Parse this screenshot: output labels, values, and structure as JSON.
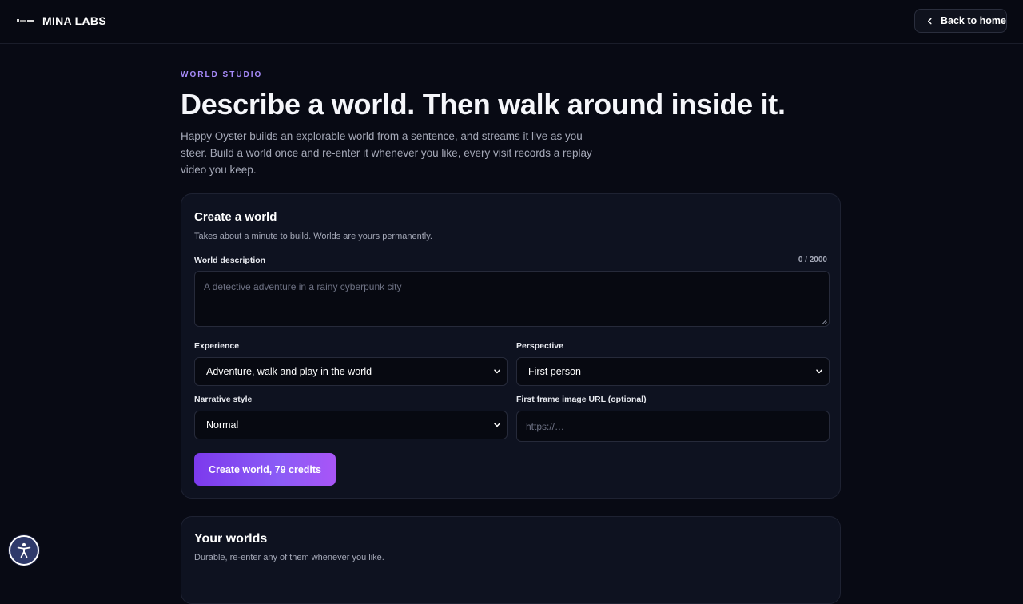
{
  "header": {
    "brand_name": "MINA LABS",
    "back_label": "Back to home"
  },
  "hero": {
    "eyebrow": "WORLD STUDIO",
    "headline": "Describe a world. Then walk around inside it.",
    "lede": "Happy Oyster builds an explorable world from a sentence, and streams it live as you steer. Build a world once and re-enter it whenever you like, every visit records a replay video you keep."
  },
  "create_card": {
    "title": "Create a world",
    "subtitle": "Takes about a minute to build. Worlds are yours permanently.",
    "description_label": "World description",
    "description_counter": "0 / 2000",
    "description_placeholder": "A detective adventure in a rainy cyberpunk city",
    "experience_label": "Experience",
    "experience_value": "Adventure, walk and play in the world",
    "perspective_label": "Perspective",
    "perspective_value": "First person",
    "narrative_label": "Narrative style",
    "narrative_value": "Normal",
    "first_frame_label": "First frame image URL (optional)",
    "first_frame_placeholder": "https://…",
    "submit_label": "Create world, 79 credits"
  },
  "worlds_card": {
    "title": "Your worlds",
    "subtitle": "Durable, re-enter any of them whenever you like."
  },
  "colors": {
    "accent": "#8b5cf6",
    "eyebrow": "#a78bfa",
    "background": "#080a14",
    "card": "#0e1220"
  },
  "icons": {
    "back": "chevron-left-icon",
    "select": "chevron-down-icon",
    "accessibility": "accessibility-icon",
    "logo": "brand-logo-icon"
  }
}
